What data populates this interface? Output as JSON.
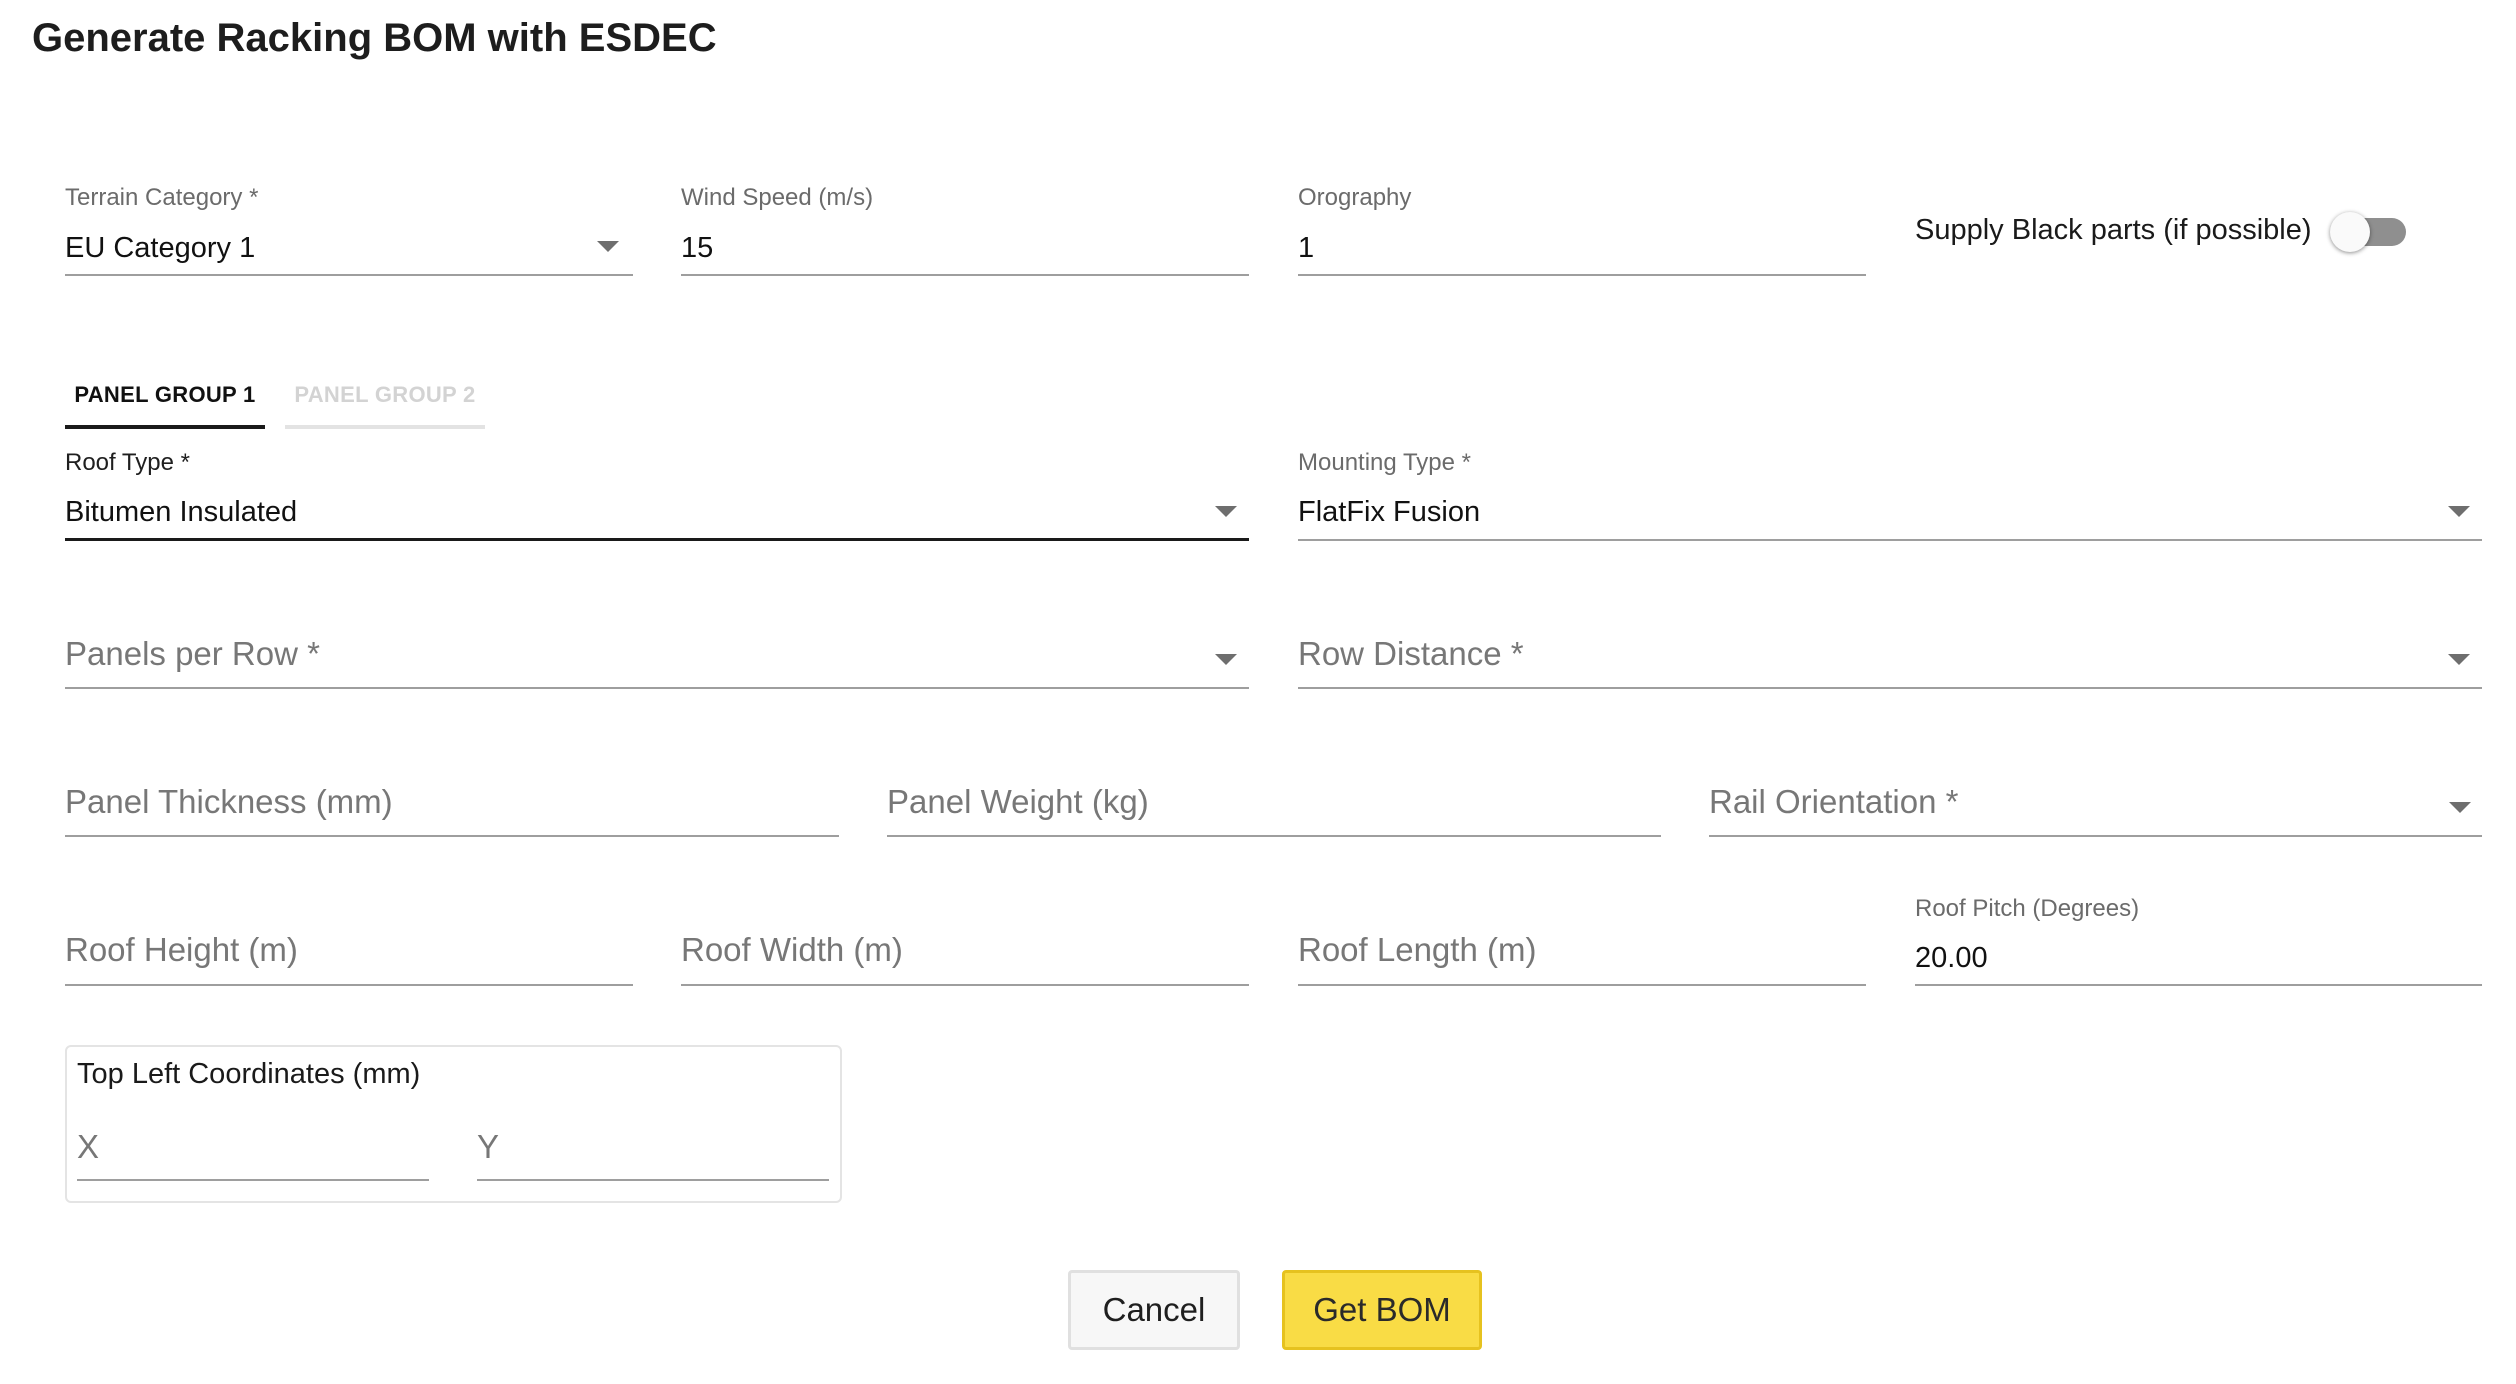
{
  "dialog": {
    "title": "Generate Racking BOM with ESDEC"
  },
  "colors": {
    "accent_yellow": "#f9dc45",
    "switch_track_off": "#8f8f8f",
    "tab_indicator_active": "#1a1a1a",
    "tab_indicator_inactive": "#e3e3e3"
  },
  "top_row": {
    "terrain_category": {
      "label": "Terrain Category *",
      "value": "EU Category 1"
    },
    "wind_speed": {
      "label": "Wind Speed (m/s)",
      "value": "15"
    },
    "orography": {
      "label": "Orography",
      "value": "1"
    },
    "supply_black_parts": {
      "label": "Supply Black parts (if possible)",
      "enabled": false
    }
  },
  "tabs": [
    {
      "label": "PANEL GROUP 1",
      "active": true
    },
    {
      "label": "PANEL GROUP 2",
      "active": false
    }
  ],
  "panel_group": {
    "roof_type": {
      "label": "Roof Type *",
      "value": "Bitumen Insulated"
    },
    "mounting_type": {
      "label": "Mounting Type *",
      "value": "FlatFix Fusion"
    },
    "panels_per_row": {
      "placeholder": "Panels per Row *"
    },
    "row_distance": {
      "placeholder": "Row Distance *"
    },
    "panel_thickness": {
      "placeholder": "Panel Thickness (mm)"
    },
    "panel_weight": {
      "placeholder": "Panel Weight (kg)"
    },
    "rail_orientation": {
      "placeholder": "Rail Orientation *"
    },
    "roof_height": {
      "placeholder": "Roof Height (m)"
    },
    "roof_width": {
      "placeholder": "Roof Width (m)"
    },
    "roof_length": {
      "placeholder": "Roof Length (m)"
    },
    "roof_pitch": {
      "label": "Roof Pitch (Degrees)",
      "value": "20.00"
    },
    "top_left_coordinates": {
      "label": "Top Left Coordinates (mm)",
      "x_placeholder": "X",
      "y_placeholder": "Y"
    }
  },
  "actions": {
    "cancel_label": "Cancel",
    "submit_label": "Get BOM"
  },
  "icons": {
    "dropdown": "caret-down-icon"
  }
}
